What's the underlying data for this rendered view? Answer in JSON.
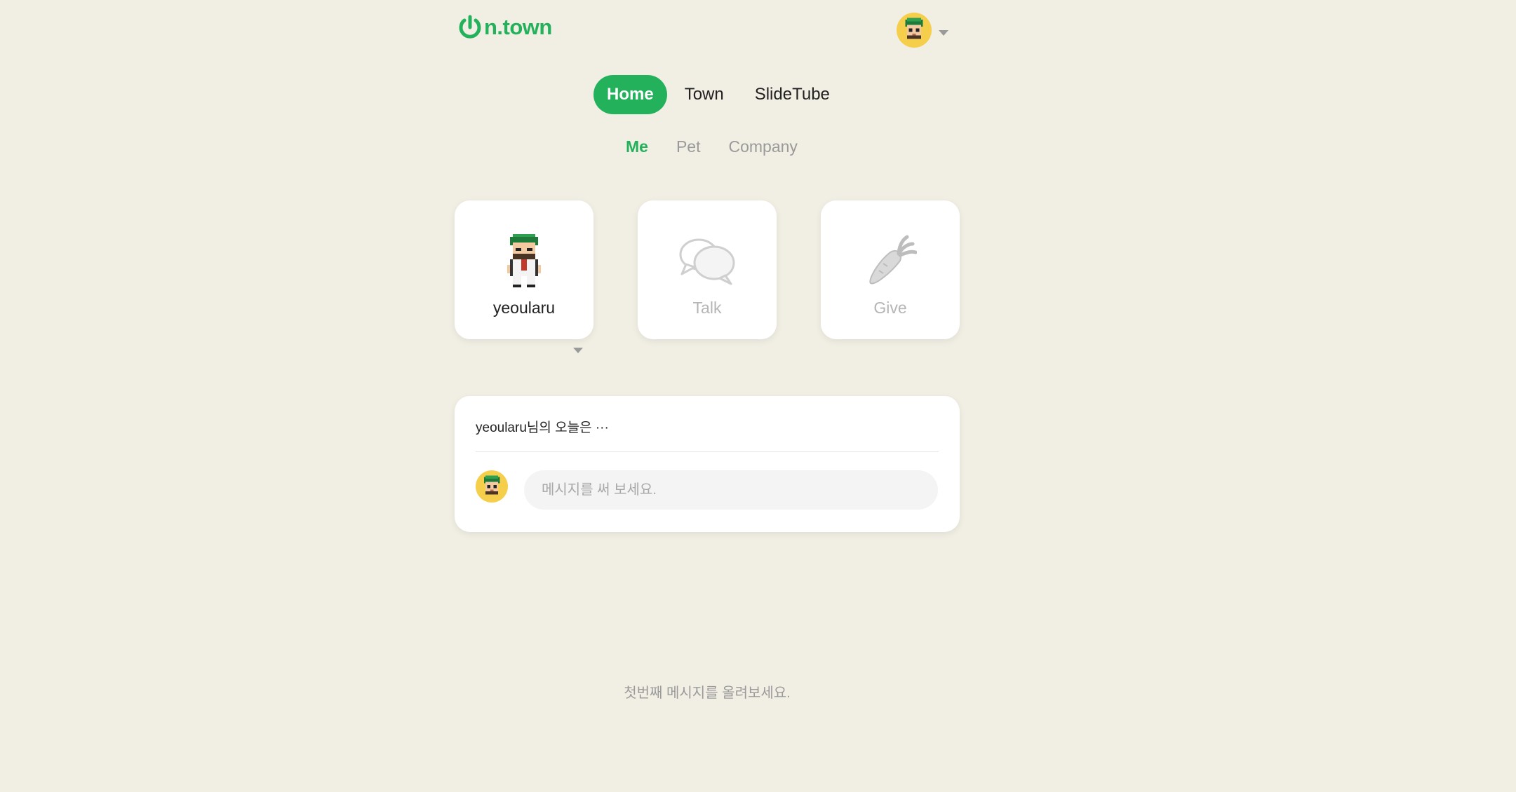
{
  "header": {
    "logo_text": "n.town",
    "brand_color": "#24b15c",
    "profile_icon": "user-avatar"
  },
  "main_nav": [
    {
      "label": "Home",
      "active": true
    },
    {
      "label": "Town",
      "active": false
    },
    {
      "label": "SlideTube",
      "active": false
    }
  ],
  "sub_nav": [
    {
      "label": "Me",
      "active": true
    },
    {
      "label": "Pet",
      "active": false
    },
    {
      "label": "Company",
      "active": false
    }
  ],
  "cards": {
    "me": {
      "label": "yeoularu",
      "icon": "pixel-character-icon"
    },
    "talk": {
      "label": "Talk",
      "icon": "speech-bubbles-icon"
    },
    "give": {
      "label": "Give",
      "icon": "carrot-icon"
    }
  },
  "panel": {
    "title": "yeoularu님의 오늘은 ···",
    "input_placeholder": "메시지를 써 보세요.",
    "input_value": ""
  },
  "empty_note": "첫번째 메시지를 올려보세요."
}
